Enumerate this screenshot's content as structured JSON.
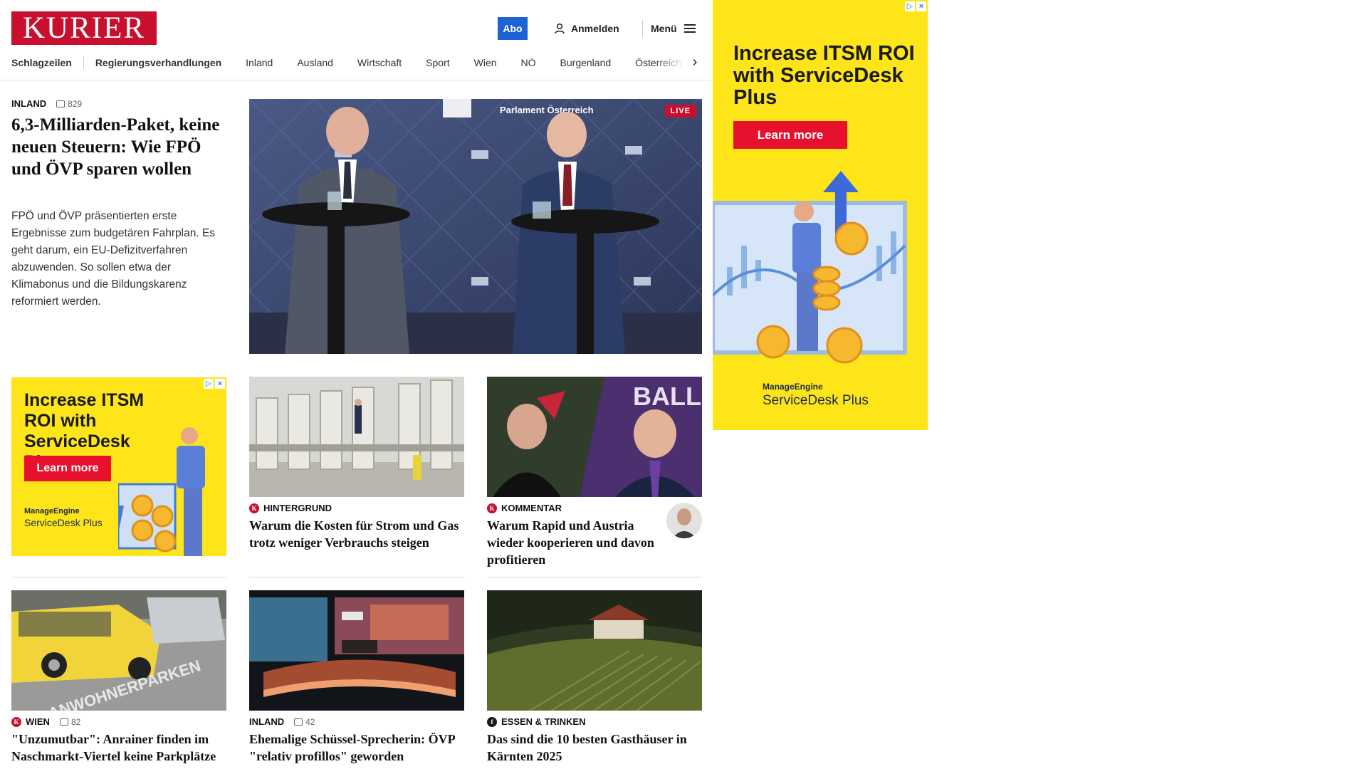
{
  "header": {
    "logo": "KURIER",
    "abo_label": "Abo",
    "login_label": "Anmelden",
    "menu_label": "Menü"
  },
  "nav": {
    "items": [
      "Schlagzeilen",
      "Regierungsverhandlungen",
      "Inland",
      "Ausland",
      "Wirtschaft",
      "Sport",
      "Wien",
      "NÖ",
      "Burgenland",
      "Österreich"
    ]
  },
  "lead": {
    "category": "INLAND",
    "comments": "829",
    "title": "6,3-Milliarden-Paket, keine neuen Steuern: Wie FPÖ und ÖVP sparen wollen",
    "text": "FPÖ und ÖVP präsentierten erste Ergebnisse zum budgetären Fahrplan. Es geht darum, ein EU-Defizitverfahren abzuwenden. So sollen etwa der Klimabonus und die Bildungskarenz reformiert werden.",
    "live_label": "LIVE",
    "banner_text": "Parlament Österreich"
  },
  "ad_right": {
    "title": "Increase ITSM ROI with ServiceDesk Plus",
    "button": "Learn more",
    "brand_small": "ManageEngine",
    "brand_large": "ServiceDesk Plus"
  },
  "ad_small": {
    "title": "Increase ITSM ROI with ServiceDesk Plus",
    "button": "Learn more",
    "brand_small": "ManageEngine",
    "brand_large": "ServiceDesk Plus"
  },
  "cards": [
    {
      "category": "HINTERGRUND",
      "title": "Warum die Kosten für Strom und Gas trotz weniger Verbrauchs steigen"
    },
    {
      "category": "KOMMENTAR",
      "title": "Warum Rapid und Austria wieder kooperieren und davon profitieren"
    },
    {
      "category": "WIEN",
      "comments": "82",
      "title": "\"Unzumutbar\": Anrainer finden im Naschmarkt-Viertel keine Parkplätze"
    },
    {
      "category": "INLAND",
      "comments": "42",
      "title": "Ehemalige Schüssel-Sprecherin: ÖVP \"relativ profillos\" geworden"
    },
    {
      "category": "ESSEN & TRINKEN",
      "title": "Das sind die 10 besten Gasthäuser in Kärnten 2025"
    }
  ],
  "image_texts": {
    "street_marking": "ANWOHNERPARKEN",
    "football_banner": "BALL"
  },
  "colors": {
    "brand_red": "#c8102e",
    "abo_blue": "#1e63d6",
    "ad_yellow": "#fde51a",
    "ad_button_red": "#e8112d"
  }
}
